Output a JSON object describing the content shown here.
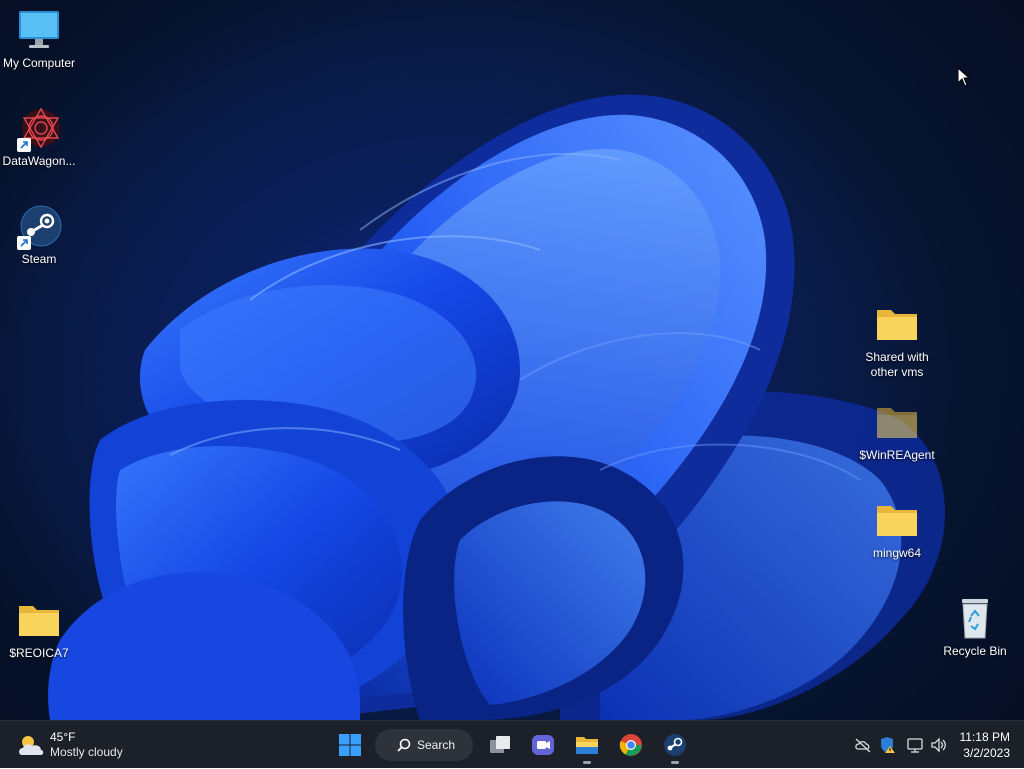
{
  "desktop": {
    "icons_left": [
      {
        "label": "My Computer",
        "icon": "monitor-icon"
      },
      {
        "label": "DataWagon...",
        "icon": "datawagon-app-icon"
      },
      {
        "label": "Steam",
        "icon": "steam-icon"
      },
      {
        "label": "$REOICA7",
        "icon": "folder-icon"
      }
    ],
    "icons_right": [
      {
        "label_line1": "Shared with",
        "label_line2": "other vms",
        "icon": "folder-icon"
      },
      {
        "label": "$WinREAgent",
        "icon": "folder-icon"
      },
      {
        "label": "mingw64",
        "icon": "folder-icon"
      },
      {
        "label": "Recycle Bin",
        "icon": "recycle-bin-icon"
      }
    ]
  },
  "taskbar": {
    "weather": {
      "temperature": "45°F",
      "condition": "Mostly cloudy",
      "icon": "partly-cloudy-icon"
    },
    "search_label": "Search",
    "pinned_apps": [
      "start-icon",
      "task-view-icon",
      "teams-chat-icon",
      "file-explorer-icon",
      "chrome-icon",
      "steam-icon"
    ],
    "tray_icons": [
      "onedrive-offline-icon",
      "security-warning-icon",
      "network-icon",
      "volume-icon"
    ],
    "clock": {
      "time": "11:18 PM",
      "date": "3/2/2023"
    }
  },
  "colors": {
    "taskbar_bg": "#1c2028",
    "folder_yellow": "#f8d45c",
    "bloom_blue": "#1a5cff",
    "start_blue": "#3aa0ff"
  }
}
